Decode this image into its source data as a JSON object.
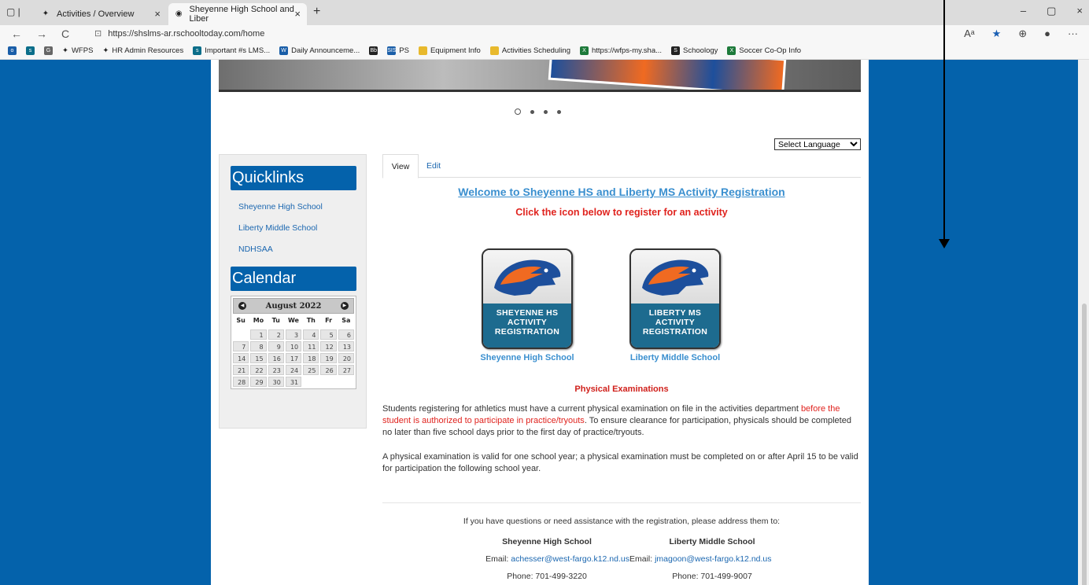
{
  "browser": {
    "tabs": [
      {
        "title": "Activities / Overview",
        "close": "×"
      },
      {
        "title": "Sheyenne High School and Liber",
        "close": "×"
      }
    ],
    "new_tab": "+",
    "window_controls": [
      "–",
      "▢",
      "×"
    ],
    "url": "https://shslms-ar.rschooltoday.com/home",
    "nav_icons": [
      "←",
      "→",
      "C"
    ],
    "right_icons": [
      "Aᵃ",
      "★",
      "⊕",
      "●",
      "···"
    ],
    "bookmarks": [
      {
        "icon": "G",
        "label": ""
      },
      {
        "icon": "",
        "label": "WFPS"
      },
      {
        "icon": "",
        "label": "HR Admin Resources"
      },
      {
        "icon": "",
        "label": "Important #s LMS..."
      },
      {
        "icon": "W",
        "label": "Daily Announceme..."
      },
      {
        "icon": "Bb",
        "label": ""
      },
      {
        "icon": "SIS",
        "label": "PS"
      },
      {
        "icon": "",
        "label": "Equipment Info"
      },
      {
        "icon": "",
        "label": "Activities Scheduling"
      },
      {
        "icon": "X",
        "label": "https://wfps-my.sha..."
      },
      {
        "icon": "S",
        "label": "Schoology"
      },
      {
        "icon": "X",
        "label": "Soccer Co-Op Info"
      }
    ]
  },
  "page": {
    "language_select": "Select Language",
    "sidebar": {
      "quicklinks_title": "Quicklinks",
      "links": [
        "Sheyenne High School",
        "Liberty Middle School",
        "NDHSAA"
      ],
      "calendar_title": "Calendar"
    },
    "calendar": {
      "month": "August 2022",
      "prev": "◀",
      "next": "▶",
      "dow": [
        "Su",
        "Mo",
        "Tu",
        "We",
        "Th",
        "Fr",
        "Sa"
      ],
      "days": [
        "",
        "1",
        "2",
        "3",
        "4",
        "5",
        "6",
        "7",
        "8",
        "9",
        "10",
        "11",
        "12",
        "13",
        "14",
        "15",
        "16",
        "17",
        "18",
        "19",
        "20",
        "21",
        "22",
        "23",
        "24",
        "25",
        "26",
        "27",
        "28",
        "29",
        "30",
        "31",
        "",
        "",
        ""
      ]
    },
    "tabs": {
      "view": "View",
      "edit": "Edit"
    },
    "welcome": "Welcome to Sheyenne HS and Liberty MS Activity Registration",
    "click_note": "Click the icon below to register for an activity",
    "cards": [
      {
        "line1": "SHEYENNE HS",
        "line2": "ACTIVITY",
        "line3": "REGISTRATION",
        "caption": "Sheyenne High School"
      },
      {
        "line1": "LIBERTY MS",
        "line2": "ACTIVITY",
        "line3": "REGISTRATION",
        "caption": "Liberty Middle School"
      }
    ],
    "physical": {
      "title": "Physical Examinations",
      "p1_start": "Students registering for athletics must have a current physical examination on file in the activities department ",
      "p1_red": "before the student is authorized to participate in practice/tryouts",
      "p1_end": ". To ensure clearance for participation, physicals should be completed no later than five school days prior to the first day of practice/tryouts.",
      "p2": "A physical examination is valid for one school year; a physical examination must be completed on or after April 15 to be valid for participation the following school year."
    },
    "contact": {
      "question": "If you have questions or need assistance with the registration, please address them to:",
      "left_name": "Sheyenne High School",
      "right_name": "Liberty Middle School",
      "email_label": "Email: ",
      "left_email": "achesser@west-fargo.k12.nd.us",
      "right_email": "jmagoon@west-fargo.k12.nd.us",
      "left_phone": "Phone: 701-499-3220",
      "right_phone": "Phone: 701-499-9007"
    }
  },
  "colors": {
    "page_blue": "#0462ab",
    "link_blue": "#1b67b0",
    "alert_red": "#e0231e"
  }
}
